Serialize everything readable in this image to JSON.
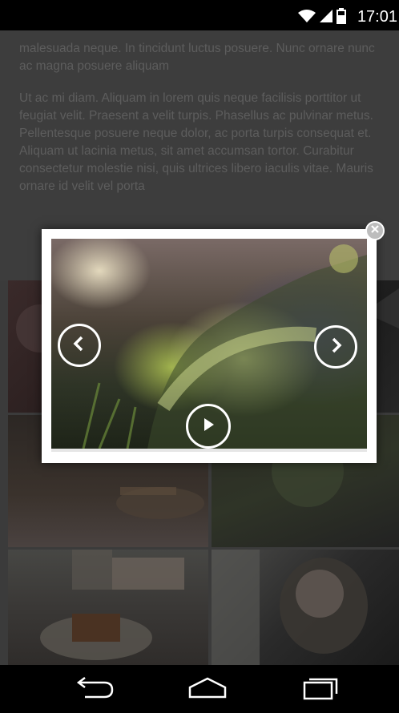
{
  "status_bar": {
    "time": "17:01",
    "icons": [
      "wifi-icon",
      "signal-icon",
      "battery-icon"
    ]
  },
  "article": {
    "paragraphs": [
      "malesuada neque. In tincidunt luctus posuere. Nunc ornare nunc ac magna posuere aliquam",
      "Ut ac mi diam. Aliquam in lorem quis neque facilisis porttitor ut feugiat velit. Praesent a velit turpis. Phasellus ac pulvinar metus. Pellentesque posuere neque dolor, ac porta turpis consequat et. Aliquam ut lacinia metus, sit amet accumsan tortor. Curabitur consectetur molestie nisi, quis ultrices libero iaculis vitae. Mauris ornare id velit vel porta"
    ]
  },
  "lightbox": {
    "controls": [
      "close-icon",
      "chevron-left-icon",
      "chevron-right-icon",
      "play-icon"
    ]
  },
  "nav_bar": {
    "icons": [
      "back-icon",
      "home-icon",
      "recents-icon"
    ]
  },
  "colors": {
    "overlay_text": "#5d5d5d",
    "lightbox_frame": "#ffffff",
    "background": "#3b3b3b"
  }
}
